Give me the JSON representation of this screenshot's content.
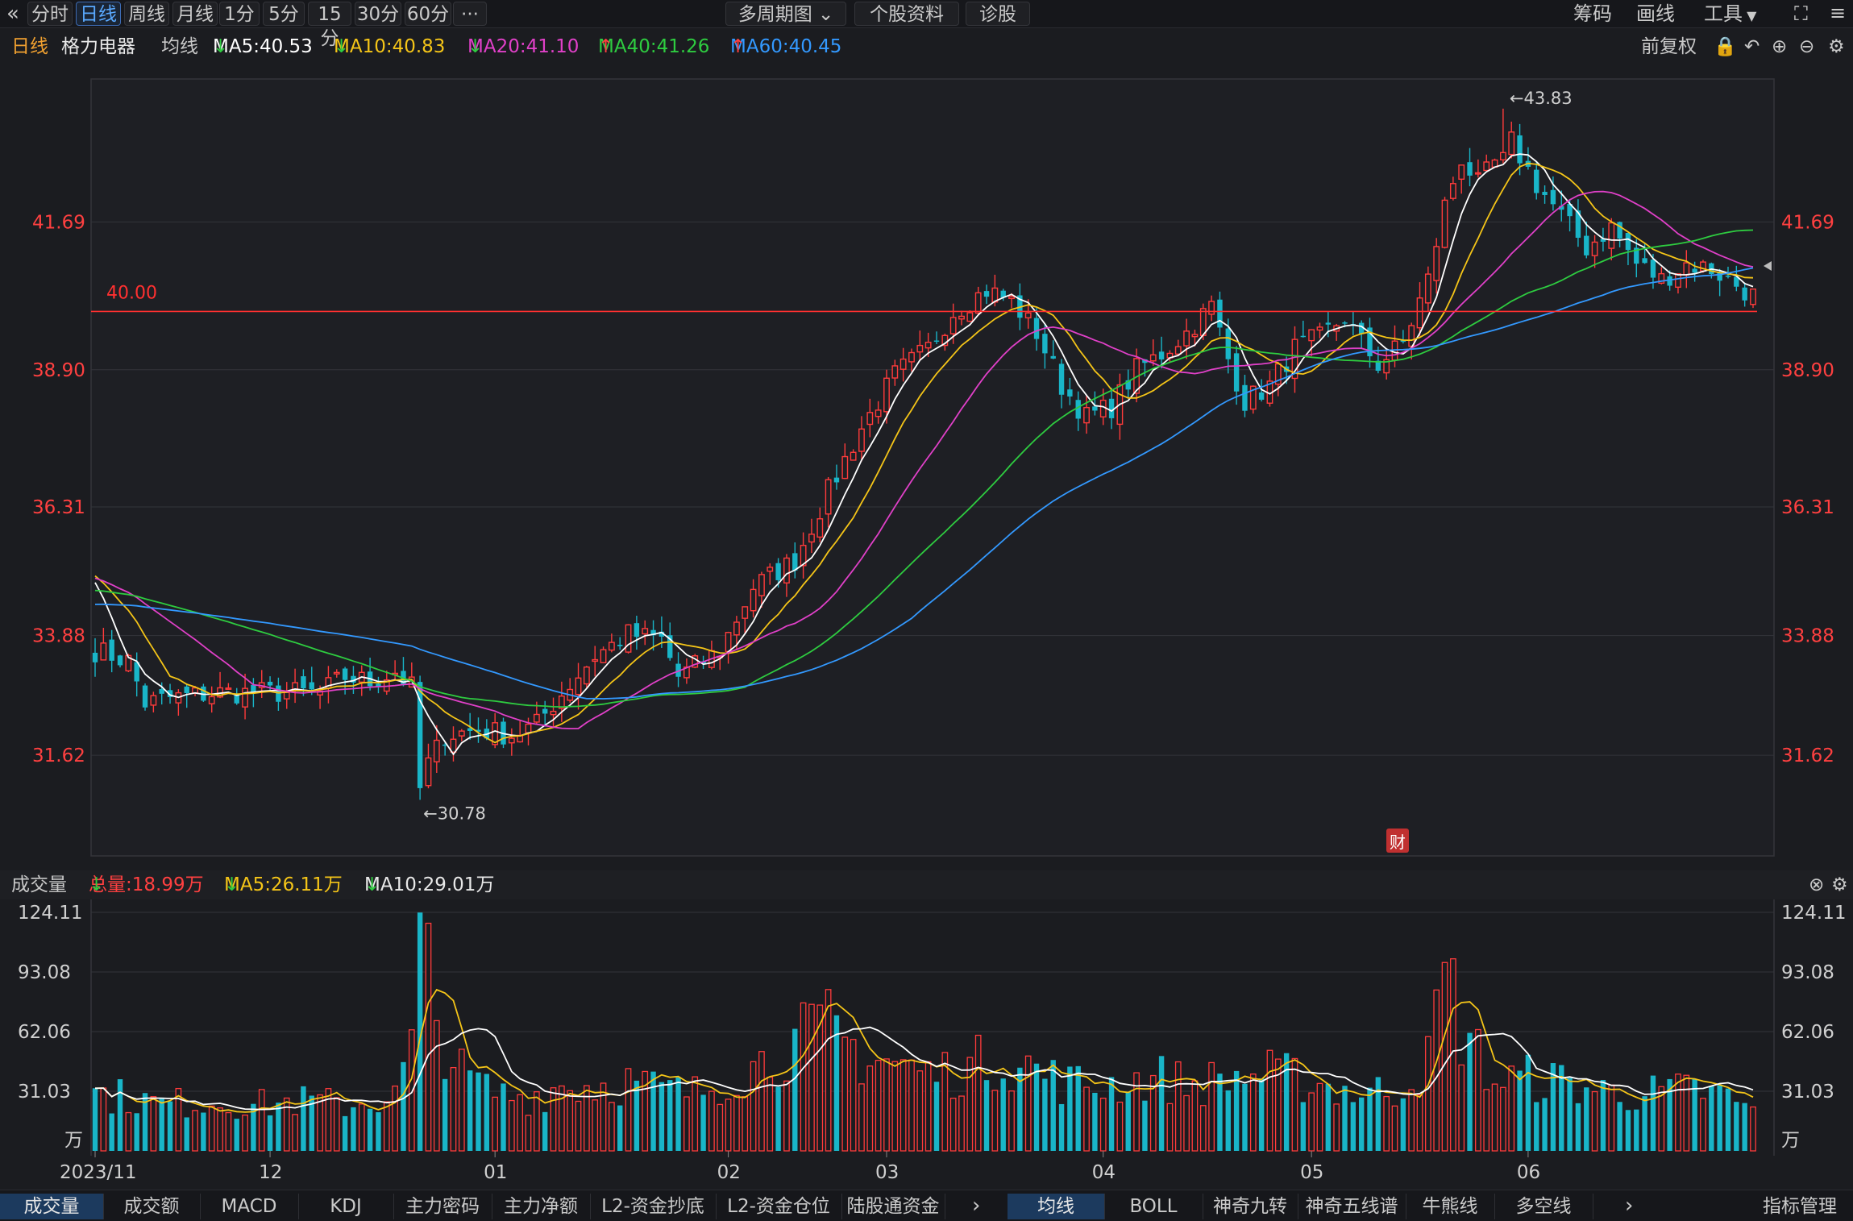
{
  "toolbar": {
    "back_icon": "double-chevron-left-icon",
    "periods": [
      "分时",
      "日线",
      "周线",
      "月线",
      "1分",
      "5分",
      "15分",
      "30分",
      "60分",
      "···"
    ],
    "active_period": "日线",
    "multi_period": "多周期图",
    "stock_profile": "个股资料",
    "diagnose": "诊股",
    "right": [
      "筹码",
      "画线",
      "工具"
    ]
  },
  "info": {
    "period": "日线",
    "name": "格力电器",
    "ma_label": "均线",
    "ma": [
      {
        "label": "MA5:40.53",
        "color": "#ffffff",
        "dir": "down"
      },
      {
        "label": "MA10:40.83",
        "color": "#f5c518",
        "dir": "down"
      },
      {
        "label": "MA20:41.10",
        "color": "#e040c8",
        "dir": "down"
      },
      {
        "label": "MA40:41.26",
        "color": "#2ecc40",
        "dir": "up"
      },
      {
        "label": "MA60:40.45",
        "color": "#3399ff",
        "dir": "up"
      }
    ],
    "adjust": "前复权"
  },
  "volume_info": {
    "title": "成交量",
    "total": "总量:18.99万",
    "ma5": "MA5:26.11万",
    "ma10": "MA10:29.01万"
  },
  "bottom": {
    "left_tabs": [
      "成交量",
      "成交额",
      "MACD",
      "KDJ",
      "主力密码",
      "主力净额",
      "L2-资金抄底",
      "L2-资金仓位",
      "陆股通资金"
    ],
    "active_left": "成交量",
    "right_tabs": [
      "均线",
      "BOLL",
      "神奇九转",
      "神奇五线谱",
      "牛熊线",
      "多空线"
    ],
    "active_right": "均线",
    "manage": "指标管理"
  },
  "chart_data": {
    "type": "candlestick",
    "price_ticks": [
      "41.69",
      "38.90",
      "36.31",
      "33.88",
      "31.62"
    ],
    "price_tick_values": [
      41.69,
      38.9,
      36.31,
      33.88,
      31.62
    ],
    "price_ylim": [
      29.72,
      44.39
    ],
    "hline": {
      "value": 40.0,
      "label": "40.00",
      "color": "#ff3030"
    },
    "high_label": "←43.83",
    "high_value": 43.83,
    "low_label": "←30.78",
    "low_value": 30.78,
    "fin_marker": "财",
    "volume_ticks": [
      "124.11",
      "93.08",
      "62.06",
      "31.03"
    ],
    "volume_tick_values": [
      124.11,
      93.08,
      62.06,
      31.03
    ],
    "volume_unit": "万",
    "x_labels": [
      "2023/11",
      "12",
      "01",
      "02",
      "03",
      "04",
      "05",
      "06"
    ],
    "x_label_index": [
      0,
      21,
      48,
      76,
      95,
      121,
      146,
      172
    ],
    "n_days": 188,
    "close_anchors": [
      [
        0,
        33.6
      ],
      [
        4,
        33.4
      ],
      [
        6,
        32.6
      ],
      [
        9,
        32.7
      ],
      [
        15,
        32.8
      ],
      [
        21,
        32.8
      ],
      [
        27,
        32.8
      ],
      [
        30,
        33.1
      ],
      [
        33,
        33.0
      ],
      [
        36,
        33.2
      ],
      [
        38,
        32.9
      ],
      [
        39,
        31.2
      ],
      [
        42,
        32.0
      ],
      [
        46,
        32.1
      ],
      [
        50,
        32.0
      ],
      [
        53,
        32.2
      ],
      [
        55,
        32.6
      ],
      [
        60,
        33.5
      ],
      [
        64,
        33.9
      ],
      [
        68,
        33.8
      ],
      [
        70,
        33.1
      ],
      [
        75,
        33.6
      ],
      [
        79,
        34.8
      ],
      [
        84,
        35.3
      ],
      [
        88,
        36.6
      ],
      [
        92,
        37.8
      ],
      [
        96,
        38.8
      ],
      [
        100,
        39.3
      ],
      [
        103,
        40.0
      ],
      [
        107,
        40.4
      ],
      [
        110,
        40.2
      ],
      [
        113,
        39.6
      ],
      [
        116,
        38.6
      ],
      [
        119,
        38.0
      ],
      [
        122,
        38.2
      ],
      [
        125,
        38.9
      ],
      [
        128,
        39.2
      ],
      [
        131,
        39.6
      ],
      [
        134,
        40.1
      ],
      [
        136,
        39.1
      ],
      [
        138,
        38.3
      ],
      [
        141,
        38.6
      ],
      [
        144,
        39.3
      ],
      [
        147,
        39.5
      ],
      [
        150,
        39.9
      ],
      [
        152,
        39.4
      ],
      [
        154,
        39.0
      ],
      [
        157,
        39.4
      ],
      [
        160,
        40.6
      ],
      [
        162,
        42.0
      ],
      [
        164,
        42.9
      ],
      [
        166,
        42.4
      ],
      [
        168,
        42.8
      ],
      [
        170,
        43.2
      ],
      [
        173,
        42.4
      ],
      [
        176,
        41.8
      ],
      [
        179,
        41.2
      ],
      [
        182,
        41.6
      ],
      [
        185,
        40.9
      ],
      [
        188,
        40.6
      ],
      [
        191,
        40.9
      ],
      [
        194,
        40.8
      ],
      [
        197,
        40.5
      ],
      [
        199,
        40.3
      ]
    ],
    "volume_anchors": [
      [
        0,
        30
      ],
      [
        4,
        28
      ],
      [
        8,
        24
      ],
      [
        13,
        26
      ],
      [
        20,
        24
      ],
      [
        25,
        26
      ],
      [
        30,
        24
      ],
      [
        36,
        28
      ],
      [
        38,
        56
      ],
      [
        39,
        124
      ],
      [
        41,
        66
      ],
      [
        44,
        40
      ],
      [
        48,
        30
      ],
      [
        52,
        28
      ],
      [
        56,
        34
      ],
      [
        60,
        34
      ],
      [
        64,
        36
      ],
      [
        68,
        32
      ],
      [
        72,
        30
      ],
      [
        76,
        38
      ],
      [
        80,
        46
      ],
      [
        84,
        56
      ],
      [
        88,
        64
      ],
      [
        92,
        50
      ],
      [
        96,
        46
      ],
      [
        100,
        40
      ],
      [
        104,
        42
      ],
      [
        108,
        48
      ],
      [
        112,
        44
      ],
      [
        116,
        36
      ],
      [
        120,
        34
      ],
      [
        124,
        36
      ],
      [
        128,
        38
      ],
      [
        132,
        34
      ],
      [
        136,
        38
      ],
      [
        140,
        40
      ],
      [
        144,
        38
      ],
      [
        148,
        34
      ],
      [
        152,
        30
      ],
      [
        156,
        32
      ],
      [
        160,
        46
      ],
      [
        162,
        98
      ],
      [
        164,
        64
      ],
      [
        168,
        36
      ],
      [
        172,
        38
      ],
      [
        176,
        36
      ],
      [
        180,
        32
      ],
      [
        184,
        30
      ],
      [
        188,
        30
      ],
      [
        192,
        32
      ],
      [
        196,
        28
      ],
      [
        199,
        20
      ]
    ]
  }
}
